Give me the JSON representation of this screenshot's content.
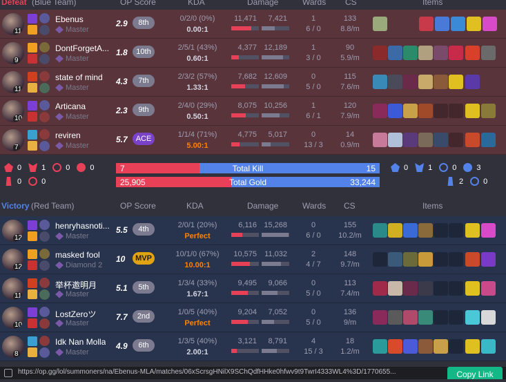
{
  "defeat_header": {
    "result": "Defeat",
    "team": "(Blue Team)",
    "op_score": "OP Score",
    "kda": "KDA",
    "damage": "Damage",
    "wards": "Wards",
    "cs": "CS",
    "items": "Items"
  },
  "victory_header": {
    "result": "Victory",
    "team": "(Red Team)",
    "op_score": "OP Score",
    "kda": "KDA",
    "damage": "Damage",
    "wards": "Wards",
    "cs": "CS",
    "items": "Items"
  },
  "blue_team": [
    {
      "level": "11",
      "name": "Ebenus",
      "tier": "Master",
      "score": "2.9",
      "rank": "8th",
      "kda": "0/2/0 (0%)",
      "ratio": "0.00:1",
      "dmg_dealt": "11,471",
      "dmg_taken": "7,421",
      "dealt_frac": 0.73,
      "taken_frac": 0.47,
      "wards": "1",
      "wards_detail": "6 / 0",
      "cs": "133",
      "cs_pm": "8.8/m"
    },
    {
      "level": "9",
      "name": "DontForgetA...",
      "tier": "Master",
      "score": "1.8",
      "rank": "10th",
      "kda": "2/5/1 (43%)",
      "ratio": "0.60:1",
      "dmg_dealt": "4,377",
      "dmg_taken": "12,189",
      "dealt_frac": 0.28,
      "taken_frac": 0.78,
      "wards": "1",
      "wards_detail": "3 / 0",
      "cs": "90",
      "cs_pm": "5.9/m"
    },
    {
      "level": "11",
      "name": "state of mind",
      "tier": "Master",
      "score": "4.3",
      "rank": "7th",
      "kda": "2/3/2 (57%)",
      "ratio": "1.33:1",
      "dmg_dealt": "7,682",
      "dmg_taken": "12,609",
      "dealt_frac": 0.49,
      "taken_frac": 0.81,
      "wards": "0",
      "wards_detail": "5 / 0",
      "cs": "115",
      "cs_pm": "7.6/m"
    },
    {
      "level": "10",
      "name": "Articana",
      "tier": "Master",
      "score": "2.3",
      "rank": "9th",
      "kda": "2/4/0 (29%)",
      "ratio": "0.50:1",
      "dmg_dealt": "8,075",
      "dmg_taken": "10,256",
      "dealt_frac": 0.52,
      "taken_frac": 0.66,
      "wards": "1",
      "wards_detail": "6 / 1",
      "cs": "120",
      "cs_pm": "7.9/m"
    },
    {
      "level": "7",
      "name": "reviren",
      "tier": "Master",
      "score": "5.7",
      "rank": "ACE",
      "kda": "1/1/4 (71%)",
      "ratio": "5.00:1",
      "dmg_dealt": "4,775",
      "dmg_taken": "5,017",
      "dealt_frac": 0.31,
      "taken_frac": 0.32,
      "wards": "0",
      "wards_detail": "13 / 3",
      "cs": "14",
      "cs_pm": "0.9/m"
    }
  ],
  "red_team": [
    {
      "level": "12",
      "name": "henryhasnoti...",
      "tier": "Master",
      "score": "5.5",
      "rank": "4th",
      "kda": "2/0/1 (20%)",
      "ratio": "Perfect",
      "dmg_dealt": "6,116",
      "dmg_taken": "15,268",
      "dealt_frac": 0.39,
      "taken_frac": 0.98,
      "wards": "0",
      "wards_detail": "6 / 0",
      "cs": "155",
      "cs_pm": "10.2/m"
    },
    {
      "level": "12",
      "name": "masked fool",
      "tier": "Diamond 2",
      "score": "10",
      "rank": "MVP",
      "kda": "10/1/0 (67%)",
      "ratio": "10.00:1",
      "dmg_dealt": "10,575",
      "dmg_taken": "11,032",
      "dealt_frac": 0.68,
      "taken_frac": 0.71,
      "wards": "2",
      "wards_detail": "4 / 7",
      "cs": "148",
      "cs_pm": "9.7/m"
    },
    {
      "level": "11",
      "name": "举杯邀明月",
      "tier": "Master",
      "score": "5.1",
      "rank": "5th",
      "kda": "1/3/4 (33%)",
      "ratio": "1.67:1",
      "dmg_dealt": "9,495",
      "dmg_taken": "9,066",
      "dealt_frac": 0.61,
      "taken_frac": 0.58,
      "wards": "0",
      "wards_detail": "5 / 0",
      "cs": "113",
      "cs_pm": "7.4/m"
    },
    {
      "level": "10",
      "name": "LostZeroツ",
      "tier": "Master",
      "score": "7.7",
      "rank": "2nd",
      "kda": "1/0/5 (40%)",
      "ratio": "Perfect",
      "dmg_dealt": "9,204",
      "dmg_taken": "7,052",
      "dealt_frac": 0.59,
      "taken_frac": 0.45,
      "wards": "0",
      "wards_detail": "5 / 0",
      "cs": "136",
      "cs_pm": "9/m"
    },
    {
      "level": "8",
      "name": "Idk Nan Molla",
      "tier": "Master",
      "score": "4.9",
      "rank": "6th",
      "kda": "1/3/5 (40%)",
      "ratio": "2.00:1",
      "dmg_dealt": "3,121",
      "dmg_taken": "8,791",
      "dealt_frac": 0.2,
      "taken_frac": 0.56,
      "wards": "4",
      "wards_detail": "15 / 3",
      "cs": "18",
      "cs_pm": "1.2/m"
    }
  ],
  "summary": {
    "kill_label": "Total Kill",
    "gold_label": "Total Gold",
    "blue_kill": "7",
    "red_kill": "15",
    "blue_kill_frac": 0.318,
    "blue_gold": "25,905",
    "red_gold": "33,244",
    "blue_gold_frac": 0.438,
    "blue_objectives": [
      "0",
      "1",
      "0",
      "0",
      "0",
      "0"
    ],
    "red_objectives": [
      "0",
      "1",
      "0",
      "3",
      "2",
      "0"
    ]
  },
  "url_bar": {
    "url": "https://op.gg/lol/summoners/na/Ebenus-MLA/matches/06xScrsgHNilX9SChQdfHHke0hfwv9t9TwrI4333WL4%3D/1770655...",
    "copy_label": "Copy Link"
  },
  "colors": {
    "blue_bar": "#5383e8",
    "red_bar": "#e84057",
    "loss_row": "#59343b",
    "win_row": "#28344e",
    "dealt": "#e84057",
    "taken": "#7b7a8e"
  }
}
